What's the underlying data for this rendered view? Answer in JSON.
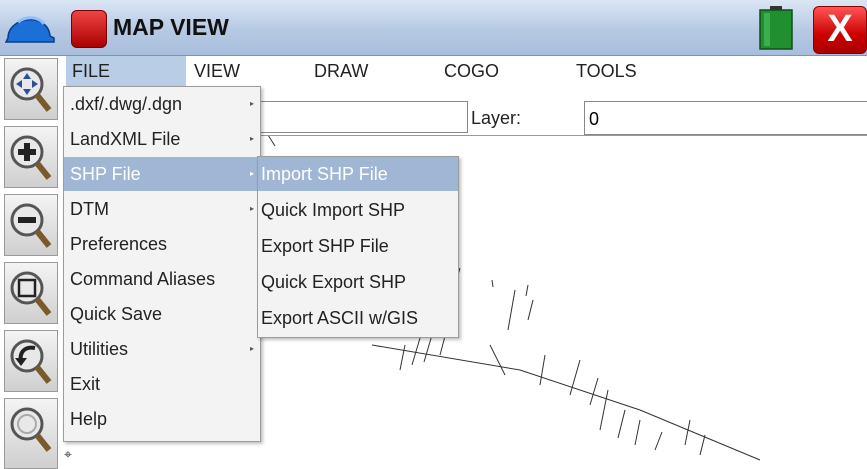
{
  "title_bar": {
    "title": "MAP VIEW",
    "close_label": "X"
  },
  "menubar": {
    "items": [
      "FILE",
      "VIEW",
      "DRAW",
      "COGO",
      "TOOLS"
    ]
  },
  "form": {
    "layer_label": "Layer:",
    "layer_value": "0"
  },
  "file_menu": {
    "items": [
      {
        "label": ".dxf/.dwg/.dgn",
        "submenu": true
      },
      {
        "label": "LandXML File",
        "submenu": true
      },
      {
        "label": "SHP File",
        "submenu": true,
        "highlighted": true
      },
      {
        "label": "DTM",
        "submenu": true
      },
      {
        "label": "Preferences",
        "submenu": false
      },
      {
        "label": "Command Aliases",
        "submenu": false
      },
      {
        "label": "Quick Save",
        "submenu": false
      },
      {
        "label": "Utilities",
        "submenu": true
      },
      {
        "label": "Exit",
        "submenu": false
      },
      {
        "label": "Help",
        "submenu": false
      }
    ]
  },
  "shp_submenu": {
    "items": [
      {
        "label": "Import SHP File",
        "highlighted": true
      },
      {
        "label": "Quick Import SHP"
      },
      {
        "label": "Export SHP File"
      },
      {
        "label": "Quick Export SHP"
      },
      {
        "label": "Export ASCII w/GIS"
      }
    ]
  },
  "toolbar": {
    "tools": [
      "pan-icon",
      "zoom-in-icon",
      "zoom-out-icon",
      "zoom-window-icon",
      "zoom-previous-icon",
      "zoom-extents-icon"
    ]
  },
  "colors": {
    "menu_highlight": "#9fb6d4",
    "title_bar": "#b6c9e3",
    "close": "#cc0000"
  }
}
